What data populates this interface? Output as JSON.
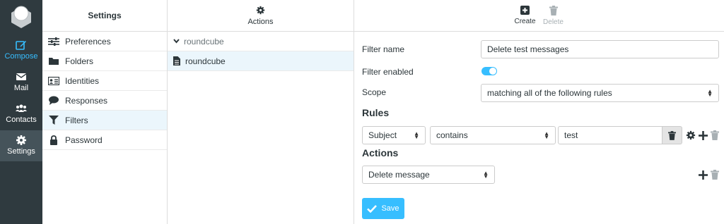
{
  "nav": {
    "items": [
      {
        "label": "Compose",
        "icon": "compose-icon"
      },
      {
        "label": "Mail",
        "icon": "mail-icon"
      },
      {
        "label": "Contacts",
        "icon": "contacts-icon"
      },
      {
        "label": "Settings",
        "icon": "gear-icon"
      }
    ]
  },
  "settings": {
    "title": "Settings",
    "items": [
      {
        "label": "Preferences",
        "icon": "sliders-icon"
      },
      {
        "label": "Folders",
        "icon": "folder-icon"
      },
      {
        "label": "Identities",
        "icon": "id-card-icon"
      },
      {
        "label": "Responses",
        "icon": "comment-icon"
      },
      {
        "label": "Filters",
        "icon": "filter-icon"
      },
      {
        "label": "Password",
        "icon": "lock-icon"
      }
    ]
  },
  "sets": {
    "actions_label": "Actions",
    "group": "roundcube",
    "item": "roundcube"
  },
  "toolbar": {
    "create_label": "Create",
    "delete_label": "Delete"
  },
  "form": {
    "filter_name_label": "Filter name",
    "filter_name_value": "Delete test messages",
    "filter_enabled_label": "Filter enabled",
    "scope_label": "Scope",
    "scope_value": "matching all of the following rules",
    "rules_heading": "Rules",
    "rule_header": "Subject",
    "rule_op": "contains",
    "rule_value": "test",
    "actions_heading": "Actions",
    "action_value": "Delete message",
    "save_label": "Save"
  },
  "colors": {
    "accent": "#37beff",
    "nav_bg": "#2f3a3f",
    "selection_bg": "#ebf6fc"
  }
}
